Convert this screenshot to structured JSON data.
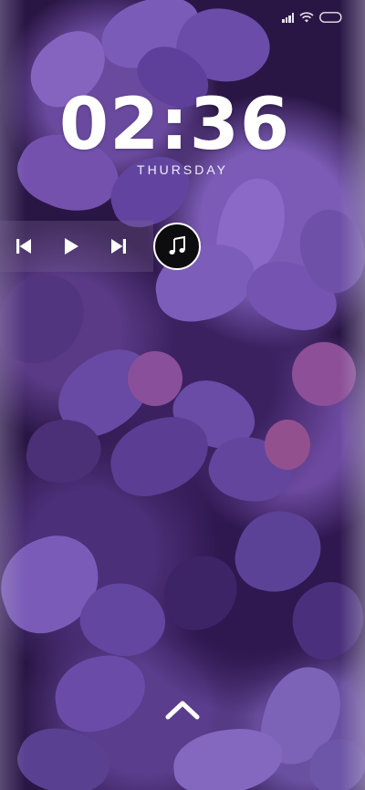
{
  "status_bar": {
    "signal_icon": "signal-icon",
    "wifi_icon": "wifi-icon",
    "battery_icon": "battery-icon"
  },
  "lockscreen": {
    "time": "02:36",
    "day": "THURSDAY"
  },
  "music_controls": {
    "previous_icon": "skip-previous-icon",
    "play_icon": "play-icon",
    "next_icon": "skip-next-icon",
    "app_icon": "music-note-icon"
  },
  "swipe_icon": "chevron-up-icon",
  "colors": {
    "text": "#ffffff",
    "music_bar_bg": "#7a6496",
    "app_circle": "#0d0d0f",
    "wallpaper_base": "#2a1645"
  }
}
